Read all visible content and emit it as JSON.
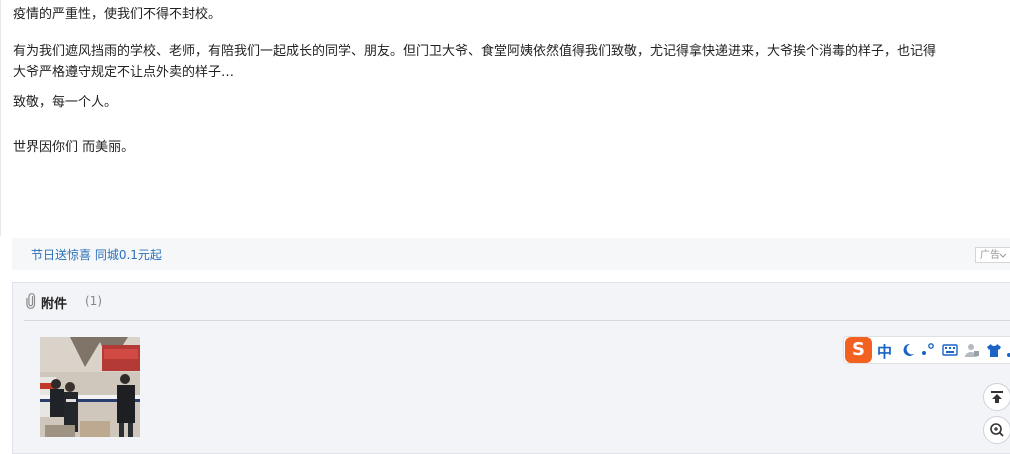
{
  "post": {
    "paragraphs": [
      "疫情的严重性，使我们不得不封校。",
      "有为我们遮风挡雨的学校、老师，有陪我们一起成长的同学、朋友。但门卫大爷、食堂阿姨依然值得我们致敬，尤记得拿快递进来，大爷挨个消毒的样子，也记得",
      "大爷严格遵守规定不让点外卖的样子…",
      "致敬，每一个人。",
      "世界因你们 而美丽。"
    ]
  },
  "ad": {
    "link_text": "节日送惊喜 同城0.1元起",
    "tag": "广告"
  },
  "attachments": {
    "title": "附件",
    "count": "(1)",
    "thumb_icon": "photo-thumbnail"
  },
  "ime": {
    "logo": "S",
    "mode": "中",
    "icons": [
      "moon-icon",
      "punctuation-icon",
      "keyboard-icon",
      "user-icon",
      "shirt-icon"
    ]
  },
  "floating": {
    "icons": [
      "back-to-top-icon",
      "zoom-icon"
    ]
  },
  "colors": {
    "link": "#2a6fb8",
    "ime_brand": "#f2611f",
    "ime_blue": "#1b63c4"
  }
}
